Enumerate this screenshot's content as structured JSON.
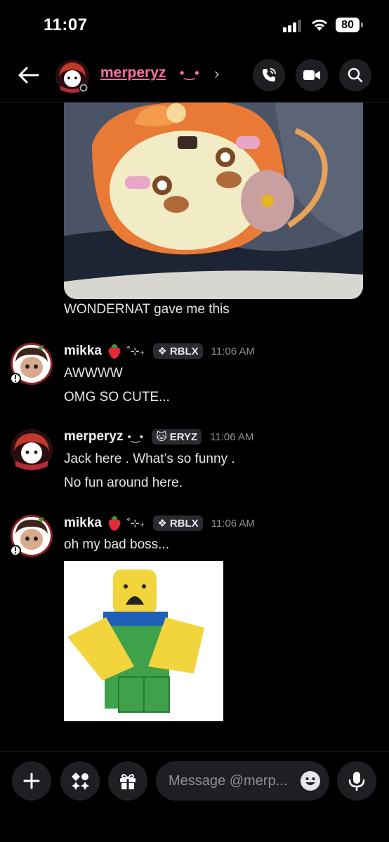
{
  "status_bar": {
    "time": "11:07",
    "battery": "80"
  },
  "header": {
    "name": "merperyz",
    "decoration": "•‿•",
    "back_icon": "back-arrow-icon",
    "icons": [
      "phone-call-icon",
      "video-call-icon",
      "search-icon"
    ]
  },
  "messages": {
    "first": {
      "caption": "WONDERNAT gave me this"
    },
    "mikka_1": {
      "name": "mikka",
      "decoration": "˚⊹₊",
      "tag": "RBLX",
      "time": "11:06 AM",
      "lines": [
        "AWWWW",
        "OMG SO CUTE..."
      ]
    },
    "merperyz": {
      "name": "merperyz",
      "decoration": "•‿•",
      "tag": "ERYZ",
      "time": "11:06 AM",
      "lines": [
        "Jack here . What’s so funny .",
        "No fun around here."
      ]
    },
    "mikka_2": {
      "name": "mikka",
      "decoration": "˚⊹₊",
      "tag": "RBLX",
      "time": "11:06 AM",
      "lines": [
        "oh my bad boss..."
      ]
    }
  },
  "composer": {
    "placeholder": "Message @merp...",
    "buttons": [
      "plus-icon",
      "apps-icon",
      "gift-icon"
    ],
    "mic_icon": "microphone-icon",
    "emoji_icon": "emoji-icon"
  },
  "colors": {
    "accent_name": "#ff6fa5",
    "background": "#000000",
    "button_bg": "#1f1f23"
  }
}
